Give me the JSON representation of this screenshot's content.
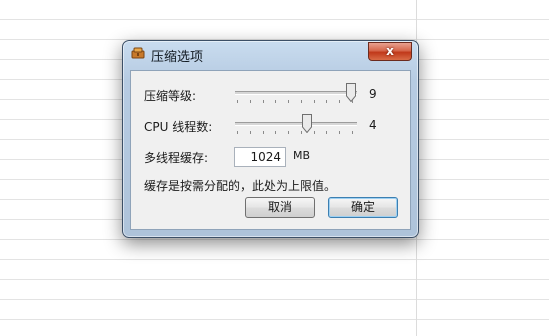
{
  "dialog": {
    "title": "压缩选项",
    "close_label": "x"
  },
  "compression_level": {
    "label": "压缩等级:",
    "value": "9",
    "min": 0,
    "max": 9
  },
  "cpu_threads": {
    "label": "CPU 线程数:",
    "value": "4",
    "min": 1,
    "max": 8
  },
  "cache": {
    "label": "多线程缓存:",
    "value": "1024",
    "unit": "MB"
  },
  "note": "缓存是按需分配的，此处为上限值。",
  "buttons": {
    "cancel": "取消",
    "ok": "确定"
  },
  "colors": {
    "frame": "#b6cbe2",
    "close": "#c0381a",
    "client": "#f0f0f0"
  }
}
